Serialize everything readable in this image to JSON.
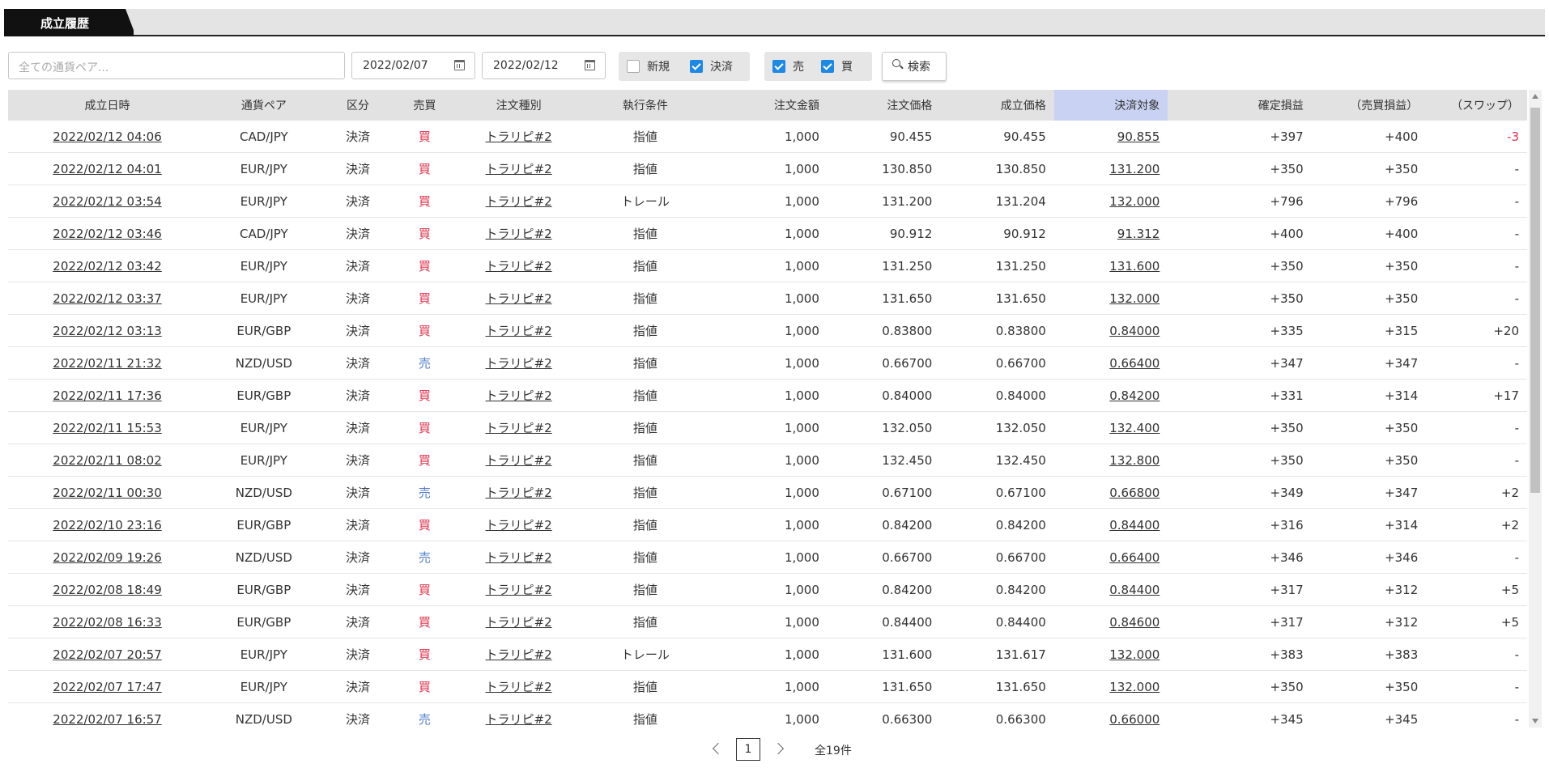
{
  "tab": {
    "label": "成立履歴"
  },
  "filters": {
    "pair_placeholder": "全ての通貨ペア...",
    "date_from": "2022/02/07",
    "date_to": "2022/02/12",
    "chk_new": {
      "label": "新規",
      "checked": false
    },
    "chk_settle": {
      "label": "決済",
      "checked": true
    },
    "chk_sell": {
      "label": "売",
      "checked": true
    },
    "chk_buy": {
      "label": "買",
      "checked": true
    },
    "search_label": "検索"
  },
  "table": {
    "headers": [
      "成立日時",
      "通貨ペア",
      "区分",
      "売買",
      "注文種別",
      "執行条件",
      "注文金額",
      "注文価格",
      "成立価格",
      "決済対象",
      "確定損益",
      "（売買損益）",
      "（スワップ）"
    ],
    "rows": [
      [
        "2022/02/12 04:06",
        "CAD/JPY",
        "決済",
        "買",
        "トラリピ#2",
        "指値",
        "1,000",
        "90.455",
        "90.455",
        "90.855",
        "+397",
        "+400",
        "-3"
      ],
      [
        "2022/02/12 04:01",
        "EUR/JPY",
        "決済",
        "買",
        "トラリピ#2",
        "指値",
        "1,000",
        "130.850",
        "130.850",
        "131.200",
        "+350",
        "+350",
        "-"
      ],
      [
        "2022/02/12 03:54",
        "EUR/JPY",
        "決済",
        "買",
        "トラリピ#2",
        "トレール",
        "1,000",
        "131.200",
        "131.204",
        "132.000",
        "+796",
        "+796",
        "-"
      ],
      [
        "2022/02/12 03:46",
        "CAD/JPY",
        "決済",
        "買",
        "トラリピ#2",
        "指値",
        "1,000",
        "90.912",
        "90.912",
        "91.312",
        "+400",
        "+400",
        "-"
      ],
      [
        "2022/02/12 03:42",
        "EUR/JPY",
        "決済",
        "買",
        "トラリピ#2",
        "指値",
        "1,000",
        "131.250",
        "131.250",
        "131.600",
        "+350",
        "+350",
        "-"
      ],
      [
        "2022/02/12 03:37",
        "EUR/JPY",
        "決済",
        "買",
        "トラリピ#2",
        "指値",
        "1,000",
        "131.650",
        "131.650",
        "132.000",
        "+350",
        "+350",
        "-"
      ],
      [
        "2022/02/12 03:13",
        "EUR/GBP",
        "決済",
        "買",
        "トラリピ#2",
        "指値",
        "1,000",
        "0.83800",
        "0.83800",
        "0.84000",
        "+335",
        "+315",
        "+20"
      ],
      [
        "2022/02/11 21:32",
        "NZD/USD",
        "決済",
        "売",
        "トラリピ#2",
        "指値",
        "1,000",
        "0.66700",
        "0.66700",
        "0.66400",
        "+347",
        "+347",
        "-"
      ],
      [
        "2022/02/11 17:36",
        "EUR/GBP",
        "決済",
        "買",
        "トラリピ#2",
        "指値",
        "1,000",
        "0.84000",
        "0.84000",
        "0.84200",
        "+331",
        "+314",
        "+17"
      ],
      [
        "2022/02/11 15:53",
        "EUR/JPY",
        "決済",
        "買",
        "トラリピ#2",
        "指値",
        "1,000",
        "132.050",
        "132.050",
        "132.400",
        "+350",
        "+350",
        "-"
      ],
      [
        "2022/02/11 08:02",
        "EUR/JPY",
        "決済",
        "買",
        "トラリピ#2",
        "指値",
        "1,000",
        "132.450",
        "132.450",
        "132.800",
        "+350",
        "+350",
        "-"
      ],
      [
        "2022/02/11 00:30",
        "NZD/USD",
        "決済",
        "売",
        "トラリピ#2",
        "指値",
        "1,000",
        "0.67100",
        "0.67100",
        "0.66800",
        "+349",
        "+347",
        "+2"
      ],
      [
        "2022/02/10 23:16",
        "EUR/GBP",
        "決済",
        "買",
        "トラリピ#2",
        "指値",
        "1,000",
        "0.84200",
        "0.84200",
        "0.84400",
        "+316",
        "+314",
        "+2"
      ],
      [
        "2022/02/09 19:26",
        "NZD/USD",
        "決済",
        "売",
        "トラリピ#2",
        "指値",
        "1,000",
        "0.66700",
        "0.66700",
        "0.66400",
        "+346",
        "+346",
        "-"
      ],
      [
        "2022/02/08 18:49",
        "EUR/GBP",
        "決済",
        "買",
        "トラリピ#2",
        "指値",
        "1,000",
        "0.84200",
        "0.84200",
        "0.84400",
        "+317",
        "+312",
        "+5"
      ],
      [
        "2022/02/08 16:33",
        "EUR/GBP",
        "決済",
        "買",
        "トラリピ#2",
        "指値",
        "1,000",
        "0.84400",
        "0.84400",
        "0.84600",
        "+317",
        "+312",
        "+5"
      ],
      [
        "2022/02/07 20:57",
        "EUR/JPY",
        "決済",
        "買",
        "トラリピ#2",
        "トレール",
        "1,000",
        "131.600",
        "131.617",
        "132.000",
        "+383",
        "+383",
        "-"
      ],
      [
        "2022/02/07 17:47",
        "EUR/JPY",
        "決済",
        "買",
        "トラリピ#2",
        "指値",
        "1,000",
        "131.650",
        "131.650",
        "132.000",
        "+350",
        "+350",
        "-"
      ],
      [
        "2022/02/07 16:57",
        "NZD/USD",
        "決済",
        "売",
        "トラリピ#2",
        "指値",
        "1,000",
        "0.66300",
        "0.66300",
        "0.66000",
        "+345",
        "+345",
        "-"
      ]
    ]
  },
  "pagination": {
    "current_page": "1",
    "total": "全19件"
  },
  "colors": {
    "buy": "#e0304a",
    "sell": "#4f7ec9",
    "header_highlight": "#c9d2f2",
    "check_on": "#1e88e5"
  }
}
